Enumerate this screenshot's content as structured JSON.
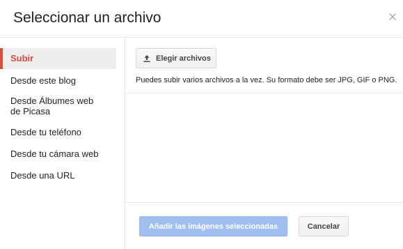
{
  "dialog": {
    "title": "Seleccionar un archivo",
    "close_icon": "close-icon"
  },
  "sidebar": {
    "items": [
      {
        "label": "Subir",
        "active": true
      },
      {
        "label": "Desde este blog",
        "active": false
      },
      {
        "label": "Desde Álbumes web de Picasa",
        "active": false
      },
      {
        "label": "Desde tu teléfono",
        "active": false
      },
      {
        "label": "Desde tu cámara web",
        "active": false
      },
      {
        "label": "Desde una URL",
        "active": false
      }
    ]
  },
  "upload": {
    "choose_label": "Elegir archivos",
    "choose_icon": "upload-icon",
    "hint": "Puedes subir varios archivos a la vez. Su formato debe ser JPG, GIF o PNG."
  },
  "footer": {
    "add_label": "Añadir las imágenes seleccionadas",
    "cancel_label": "Cancelar"
  },
  "colors": {
    "accent": "#dd4b39",
    "primary_disabled": "#a0bef2"
  }
}
